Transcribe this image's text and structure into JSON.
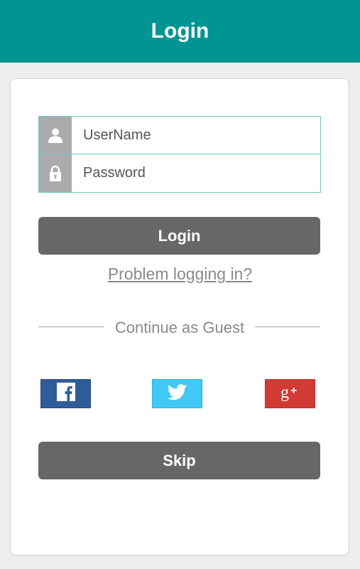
{
  "header": {
    "title": "Login"
  },
  "form": {
    "username_placeholder": "UserName",
    "password_placeholder": "Password",
    "login_label": "Login",
    "problem_link": "Problem logging in?"
  },
  "guest": {
    "label": "Continue as Guest"
  },
  "social": [
    {
      "name": "facebook",
      "icon": "facebook-icon",
      "color": "#305c99"
    },
    {
      "name": "twitter",
      "icon": "twitter-icon",
      "color": "#41c8f4"
    },
    {
      "name": "google-plus",
      "icon": "google-plus-icon",
      "color": "#d23a34"
    }
  ],
  "skip_label": "Skip",
  "colors": {
    "header_bg": "#009592",
    "button_bg": "#676767",
    "field_border": "#6fc7c5",
    "icon_bg": "#ababab"
  }
}
